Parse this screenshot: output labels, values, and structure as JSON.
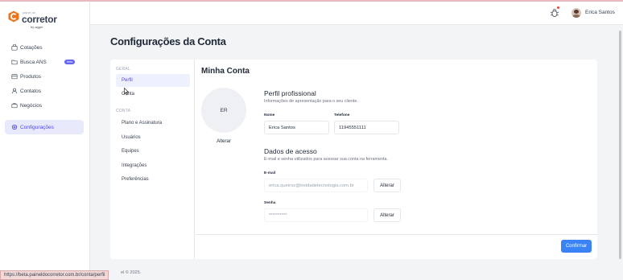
{
  "brand": {
    "small": "painel do",
    "main": "corretor",
    "by": "by agger",
    "accent": "#e8761e"
  },
  "sidebar": {
    "items": [
      {
        "label": "Cotações",
        "icon": "basket-icon"
      },
      {
        "label": "Busca ANS",
        "icon": "folder-icon",
        "badge": "beta"
      },
      {
        "label": "Produtos",
        "icon": "box-icon"
      },
      {
        "label": "Contatos",
        "icon": "person-icon"
      },
      {
        "label": "Negócios",
        "icon": "briefcase-icon"
      },
      {
        "label": "Configurações",
        "icon": "gear-icon",
        "active": true
      }
    ]
  },
  "topbar": {
    "user_name": "Erica Santos"
  },
  "page": {
    "title": "Configurações da Conta"
  },
  "settings_nav": {
    "group_general": "GERAL",
    "general_items": [
      "Perfil",
      "Conta"
    ],
    "group_account": "CONTA",
    "account_items": [
      "Plano e Assinatura",
      "Usuários",
      "Equipes",
      "Integrações",
      "Preferências"
    ]
  },
  "account": {
    "title": "Minha Conta",
    "avatar_initials": "ER",
    "change_photo_label": "Alterar",
    "profile_title": "Perfil profissional",
    "profile_subtitle": "Informações de apresentação para o seu cliente.",
    "name_label": "Nome",
    "name_value": "Erica Santos",
    "phone_label": "Telefone",
    "phone_value": "11945551111",
    "access_title": "Dados de acesso",
    "access_subtitle": "E-mail e senha utilizados para acessar sua conta na ferramenta.",
    "email_label": "E-mail",
    "email_value": "erica.queiroz@treidadetecnologia.com.br",
    "email_change": "Alterar",
    "password_label": "Senha",
    "password_value": "**********",
    "password_change": "Alterar",
    "confirm_label": "Confirmar"
  },
  "footer": {
    "text": "el © 2025."
  },
  "status_bar": {
    "url": "https://beta.paineldocorretor.com.br/conta/perfil"
  },
  "colors": {
    "primary": "#4f46e5",
    "confirm": "#3b82f6",
    "background": "#f3f4f6"
  }
}
